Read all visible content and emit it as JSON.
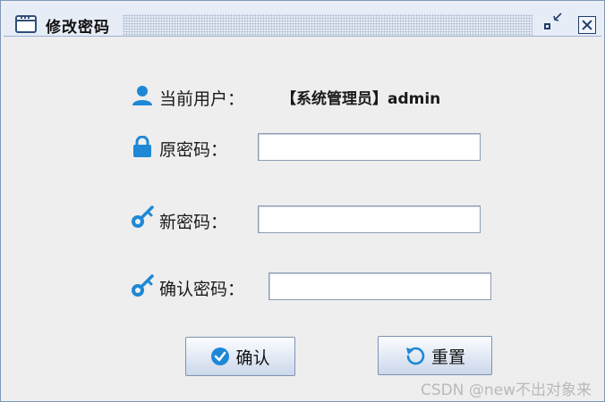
{
  "window": {
    "title": "修改密码",
    "icon": "window-icon",
    "controls": {
      "restore": "restore-icon",
      "close": "close-icon"
    }
  },
  "form": {
    "current_user_label": "当前用户：",
    "current_user_value": "【系统管理员】admin",
    "old_password_label": "原密码：",
    "new_password_label": "新密码：",
    "confirm_password_label": "确认密码：",
    "old_password_value": "",
    "new_password_value": "",
    "confirm_password_value": ""
  },
  "buttons": {
    "confirm_label": "确认",
    "reset_label": "重置"
  },
  "icons": {
    "user": "user-icon",
    "lock": "lock-icon",
    "key": "key-icon",
    "check": "check-circle-icon",
    "reset": "refresh-icon"
  },
  "colors": {
    "accent": "#1e88d6",
    "background": "#eeeeee",
    "titlebar": "#e7edf7"
  },
  "watermark": "CSDN @new不出对象来"
}
